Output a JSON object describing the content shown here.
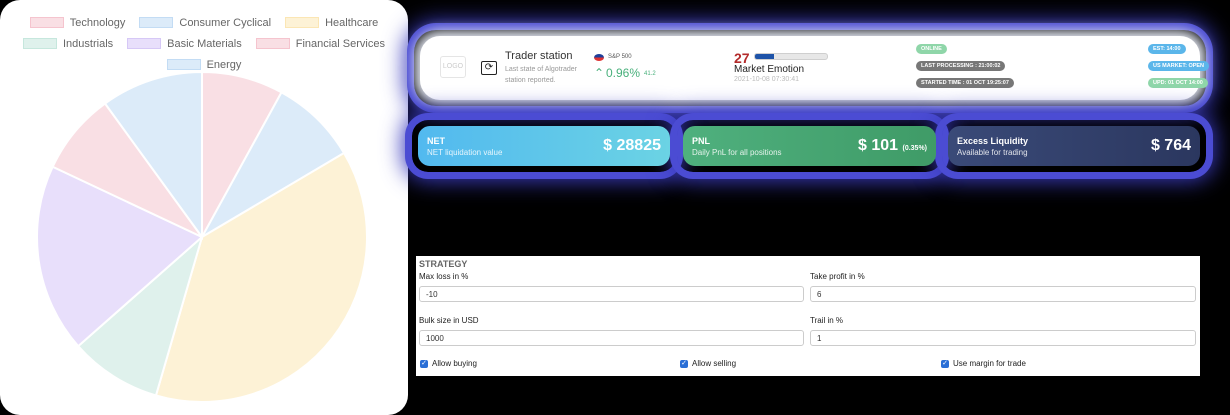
{
  "chart_data": {
    "type": "pie",
    "legend": [
      {
        "label": "Technology",
        "color": "#f9dfe4"
      },
      {
        "label": "Consumer Cyclical",
        "color": "#dcebf9"
      },
      {
        "label": "Healthcare",
        "color": "#fdf2d6"
      },
      {
        "label": "Industrials",
        "color": "#dff1ec"
      },
      {
        "label": "Basic Materials",
        "color": "#e8dffb"
      },
      {
        "label": "Financial Services",
        "color": "#f9dfe4"
      },
      {
        "label": "Energy",
        "color": "#dcebf9"
      }
    ],
    "slices": [
      {
        "label": "Technology",
        "value": 8,
        "color": "#f9dfe4"
      },
      {
        "label": "Consumer Cyclical",
        "value": 8.5,
        "color": "#dcebf9"
      },
      {
        "label": "Healthcare",
        "value": 38,
        "color": "#fdf2d6"
      },
      {
        "label": "Industrials",
        "value": 9,
        "color": "#dff1ec"
      },
      {
        "label": "Basic Materials",
        "value": 18.5,
        "color": "#e8dffb"
      },
      {
        "label": "Financial Services",
        "value": 8,
        "color": "#f9dfe4"
      },
      {
        "label": "Energy",
        "value": 10,
        "color": "#dcebf9"
      }
    ],
    "legend_position": "top"
  },
  "station": {
    "title": "Trader station",
    "description": "Last state of Algotrader station reported.",
    "logo_text": "LOGO",
    "sync_icon": "sync-icon",
    "index_label": "S&P 500",
    "index_change": "0.96%",
    "index_sub": "41.2",
    "emotion_value": "27",
    "emotion_fraction": 0.27,
    "emotion_label": "Market Emotion",
    "emotion_date": "2021-10-08 07:30:41",
    "status_online": "ONLINE",
    "last_processing": "LAST PROCESSING : 21:00:02",
    "started_time": "STARTED TIME : 01 OCT 19:25:07",
    "est": "EST: 14:00",
    "us_market": "US MARKET: OPEN",
    "upd": "UPD: 01 OCT 14:00"
  },
  "stats": {
    "net": {
      "label": "NET",
      "sub": "NET liquidation value",
      "value": "$ 28825"
    },
    "pnl": {
      "label": "PNL",
      "sub": "Daily PnL for all positions",
      "value": "$ 101",
      "pct": "(0.35%)"
    },
    "excess": {
      "label": "Excess Liquidity",
      "sub": "Available for trading",
      "value": "$ 764"
    }
  },
  "strategy": {
    "title": "STRATEGY",
    "max_loss_label": "Max loss in %",
    "max_loss_value": "-10",
    "take_profit_label": "Take profit in %",
    "take_profit_value": "6",
    "bulk_label": "Bulk size in USD",
    "bulk_value": "1000",
    "trail_label": "Trail in %",
    "trail_value": "1",
    "allow_buying": "Allow buying",
    "allow_selling": "Allow selling",
    "use_margin": "Use margin for trade"
  }
}
